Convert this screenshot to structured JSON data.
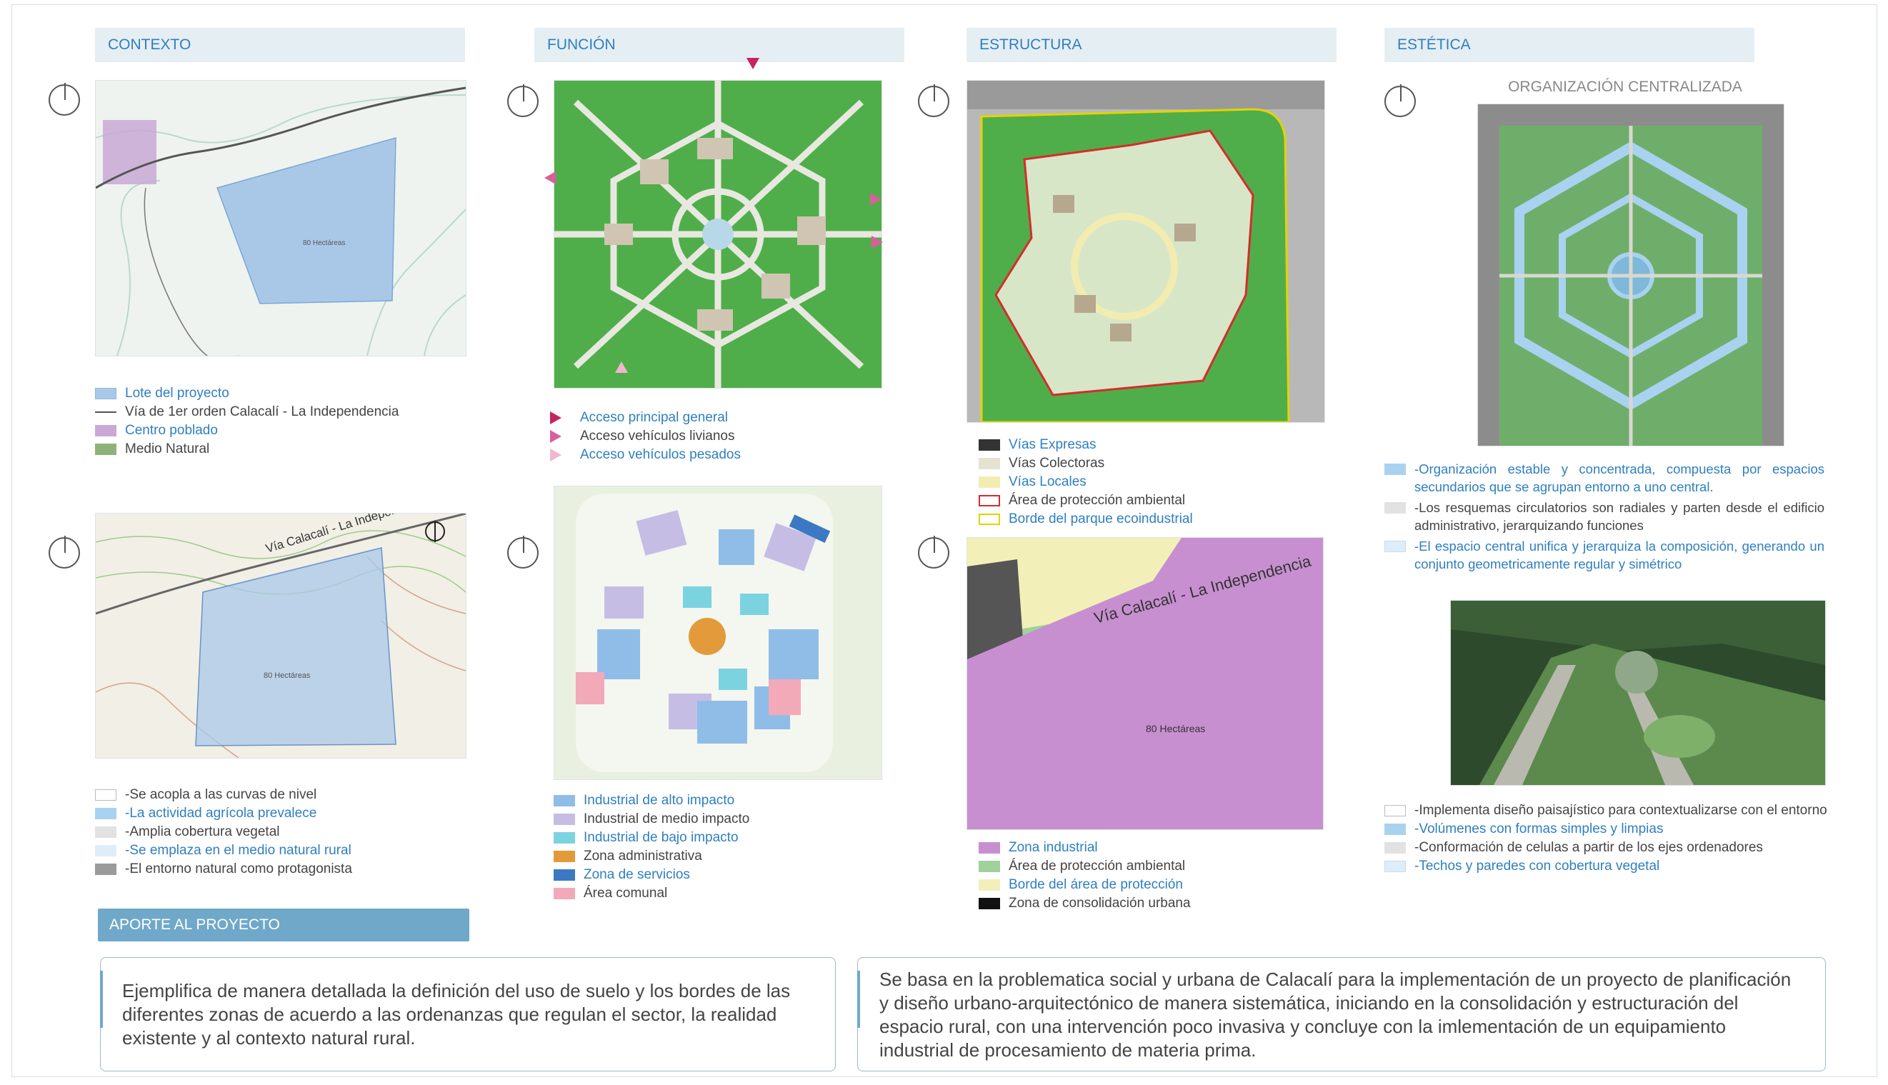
{
  "headers": {
    "contexto": "CONTEXTO",
    "funcion": "FUNCIÓN",
    "estructura": "ESTRUCTURA",
    "estetica": "ESTÉTICA"
  },
  "contexto": {
    "map1_area_label": "80 Hectáreas",
    "map2_area_label": "80 Hectáreas",
    "map2_road_label": "Vía Calacalí - La Independencia",
    "legend": [
      {
        "label": "Lote del proyecto",
        "swatch": "#a9c8e8",
        "tone": "blue"
      },
      {
        "label": "Vía de 1er orden Calacalí - La Independencia",
        "swatch": "line",
        "tone": "dark"
      },
      {
        "label": "Centro poblado",
        "swatch": "#c9a8d6",
        "tone": "blue"
      },
      {
        "label": "Medio Natural",
        "swatch": "#8fb17a",
        "tone": "dark"
      }
    ],
    "criteria": [
      {
        "label": "-Se acopla a las curvas de nivel",
        "swatch": "#ffffff",
        "tone": "dark"
      },
      {
        "label": "-La actividad agrícola prevalece",
        "swatch": "#a9d2f0",
        "tone": "blue"
      },
      {
        "label": "-Amplia cobertura vegetal",
        "swatch": "#e2e2e2",
        "tone": "dark"
      },
      {
        "label": "-Se emplaza en el medio natural rural",
        "swatch": "#ddeefa",
        "tone": "blue"
      },
      {
        "label": "-El entorno natural como protagonista",
        "swatch": "#9a9a9a",
        "tone": "dark"
      }
    ]
  },
  "funcion": {
    "access_legend": [
      {
        "label": "Acceso principal general",
        "color": "#c7245f",
        "tone": "blue"
      },
      {
        "label": "Acceso vehículos livianos",
        "color": "#d8609a",
        "tone": "dark"
      },
      {
        "label": "Acceso vehículos pesados",
        "color": "#f0b6cf",
        "tone": "blue"
      }
    ],
    "zone_legend": [
      {
        "label": "Industrial de alto impacto",
        "swatch": "#8fbde8",
        "tone": "blue"
      },
      {
        "label": "Industrial de medio impacto",
        "swatch": "#c6bde5",
        "tone": "dark"
      },
      {
        "label": "Industrial de bajo impacto",
        "swatch": "#7cd3e0",
        "tone": "blue"
      },
      {
        "label": "Zona administrativa",
        "swatch": "#e39a3a",
        "tone": "dark"
      },
      {
        "label": "Zona de servicios",
        "swatch": "#3b79c4",
        "tone": "blue"
      },
      {
        "label": "Área comunal",
        "swatch": "#f2aab8",
        "tone": "dark"
      }
    ]
  },
  "estructura": {
    "map2_area_label": "80 Hectáreas",
    "map2_road_label": "Vía Calacalí - La Independencia",
    "road_legend": [
      {
        "label": "Vías Expresas",
        "swatch": "#333333",
        "tone": "blue"
      },
      {
        "label": "Vías Colectoras",
        "swatch": "#e6e2d2",
        "tone": "dark"
      },
      {
        "label": "Vías Locales",
        "swatch": "#f2ecb0",
        "tone": "blue"
      },
      {
        "label": "Área de protección ambiental",
        "swatch": "outline-red",
        "tone": "dark"
      },
      {
        "label": "Borde del parque ecoindustrial",
        "swatch": "outline-yellow",
        "tone": "blue"
      }
    ],
    "zone_legend": [
      {
        "label": "Zona industrial",
        "swatch": "#c78fd0",
        "tone": "blue"
      },
      {
        "label": "Área de protección ambiental",
        "swatch": "#9fd19a",
        "tone": "dark"
      },
      {
        "label": "Borde del área de protección",
        "swatch": "#f2f0b8",
        "tone": "blue"
      },
      {
        "label": "Zona de consolidación urbana",
        "swatch": "#111111",
        "tone": "dark"
      }
    ]
  },
  "estetica": {
    "title": "ORGANIZACIÓN CENTRALIZADA",
    "criteria1": [
      {
        "label": "-Organización estable y concentrada, compuesta por espacios secundarios que se agrupan entorno a uno central.",
        "swatch": "#a9d2f0",
        "tone": "blue"
      },
      {
        "label": "-Los resquemas circulatorios son radiales y parten desde el edificio administrativo, jerarquizando funciones",
        "swatch": "#e2e2e2",
        "tone": "dark"
      },
      {
        "label": "-El espacio central unifica y jerarquiza la composición, generando un conjunto geometricamente regular y simétrico",
        "swatch": "#ddeefa",
        "tone": "blue"
      }
    ],
    "criteria2": [
      {
        "label": "-Implementa diseño paisajístico para contextualizarse con el entorno",
        "swatch": "#ffffff",
        "tone": "dark"
      },
      {
        "label": "-Volúmenes con formas simples y limpias",
        "swatch": "#a9d2f0",
        "tone": "blue"
      },
      {
        "label": "-Conformación de celulas a partir de los ejes ordenadores",
        "swatch": "#e2e2e2",
        "tone": "dark"
      },
      {
        "label": "-Techos y paredes con cobertura vegetal",
        "swatch": "#ddeefa",
        "tone": "blue"
      }
    ]
  },
  "aporte": {
    "button": "APORTE AL PROYECTO",
    "text_left": "Ejemplifica de manera detallada la definición del uso de suelo y  los bordes de las diferentes zonas de acuerdo a las ordenanzas que regulan el sector, la realidad existente y al contexto natural rural.",
    "text_right": "Se basa en la problematica social y urbana de Calacalí para la implementación de un proyecto de planificación y diseño urbano-arquitectónico de manera sistemática, iniciando en la consolidación y estructuración del espacio rural, con una intervención poco invasiva y concluye con la imlementación de un equipamiento industrial de procesamiento de materia prima."
  }
}
